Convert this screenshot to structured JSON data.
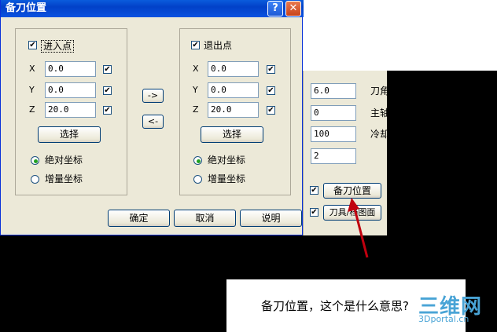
{
  "dialog": {
    "title": "备刀位置",
    "help_label": "?",
    "close_label": "✕",
    "left_group": {
      "header_label": "进入点",
      "checked": true,
      "fields": [
        {
          "axis": "X",
          "value": "0.0",
          "checked": true
        },
        {
          "axis": "Y",
          "value": "0.0",
          "checked": true
        },
        {
          "axis": "Z",
          "value": "20.0",
          "checked": true
        }
      ],
      "select_label": "选择",
      "radio_absolute": "绝对坐标",
      "radio_increment": "增量坐标"
    },
    "right_group": {
      "header_label": "退出点",
      "checked": true,
      "fields": [
        {
          "axis": "X",
          "value": "0.0",
          "checked": true
        },
        {
          "axis": "Y",
          "value": "0.0",
          "checked": true
        },
        {
          "axis": "Z",
          "value": "20.0",
          "checked": true
        }
      ],
      "select_label": "选择",
      "radio_absolute": "绝对坐标",
      "radio_increment": "增量坐标"
    },
    "copy_right_label": "->",
    "copy_left_label": "<-",
    "ok_label": "确定",
    "cancel_label": "取消",
    "help_text_label": "说明"
  },
  "background_panel": {
    "values": [
      "6.0",
      "0",
      "100",
      "2"
    ],
    "labels": [
      "刀角",
      "主轴",
      "冷却"
    ],
    "tool_position_button": "备刀位置",
    "tool_graph_button": "刀具/档图面"
  },
  "caption": "备刀位置，这个是什么意思?",
  "watermark": {
    "main": "三维网",
    "sub": "3Dportal.cn"
  },
  "colors": {
    "accent": "#0a5bdc",
    "arrow": "#c0000f"
  }
}
